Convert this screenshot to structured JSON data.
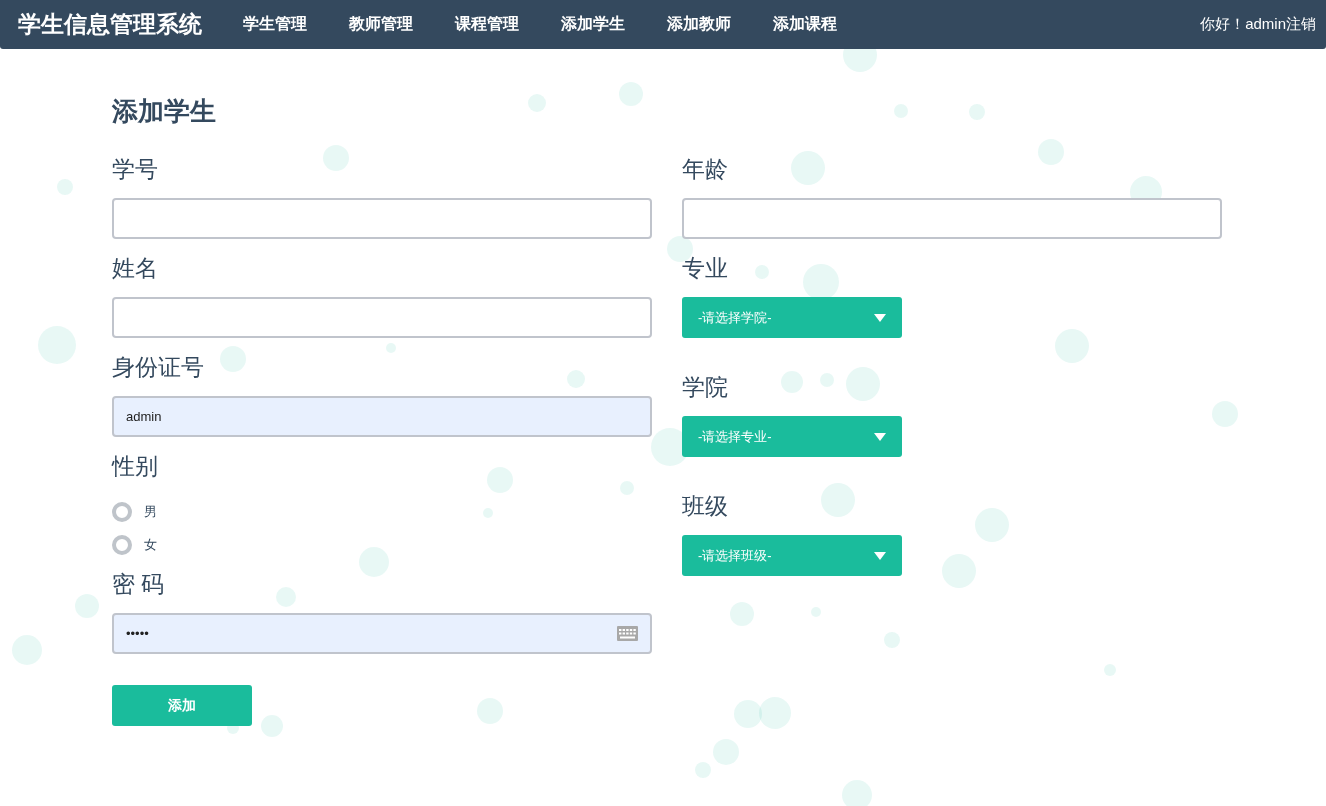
{
  "navbar": {
    "brand": "学生信息管理系统",
    "items": [
      {
        "label": "学生管理"
      },
      {
        "label": "教师管理"
      },
      {
        "label": "课程管理"
      },
      {
        "label": "添加学生"
      },
      {
        "label": "添加教师"
      },
      {
        "label": "添加课程"
      }
    ],
    "greeting": "你好！admin",
    "logout": "注销"
  },
  "page_title": "添加学生",
  "left_fields": [
    {
      "kind": "text",
      "label": "学号",
      "autofilled": false
    },
    {
      "kind": "text",
      "label": "姓名",
      "autofilled": false
    },
    {
      "kind": "text",
      "label": "身份证号",
      "value": "admin",
      "autofilled": true
    },
    {
      "kind": "radio",
      "label": "性别",
      "options": [
        {
          "label": "男",
          "selected": false
        },
        {
          "label": "女",
          "selected": false
        }
      ]
    },
    {
      "kind": "password",
      "label": "密 码",
      "value": "•••••",
      "autofilled": true
    }
  ],
  "right_fields": [
    {
      "kind": "text",
      "label": "年龄",
      "autofilled": false
    },
    {
      "kind": "select",
      "label": "专业",
      "placeholder": "-请选择学院-"
    },
    {
      "kind": "select",
      "label": "学院",
      "placeholder": "-请选择专业-"
    },
    {
      "kind": "select",
      "label": "班级",
      "placeholder": "-请选择班级-"
    }
  ],
  "submit_button": "添加"
}
